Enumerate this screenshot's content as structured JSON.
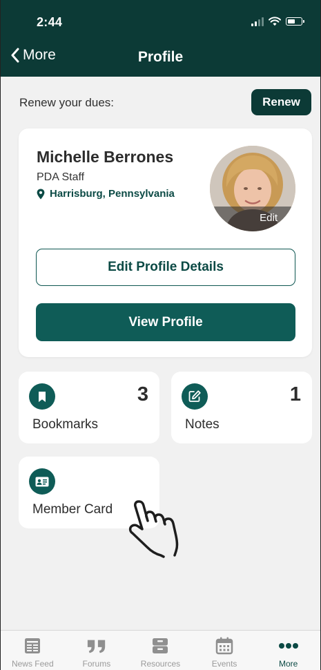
{
  "status": {
    "time": "2:44"
  },
  "nav": {
    "back_label": "More",
    "title": "Profile"
  },
  "renew": {
    "label": "Renew your dues:",
    "button_label": "Renew"
  },
  "profile": {
    "name": "Michelle Berrones",
    "role": "PDA Staff",
    "location": "Harrisburg, Pennsylvania",
    "avatar_edit_label": "Edit",
    "edit_button_label": "Edit Profile Details",
    "view_button_label": "View Profile"
  },
  "tiles": [
    {
      "label": "Bookmarks",
      "count": "3",
      "icon": "bookmark-icon"
    },
    {
      "label": "Notes",
      "count": "1",
      "icon": "edit-note-icon"
    },
    {
      "label": "Member Card",
      "icon": "id-card-icon"
    }
  ],
  "tabs": [
    {
      "label": "News Feed",
      "icon": "newspaper-icon",
      "active": false
    },
    {
      "label": "Forums",
      "icon": "quote-icon",
      "active": false
    },
    {
      "label": "Resources",
      "icon": "drawer-icon",
      "active": false
    },
    {
      "label": "Events",
      "icon": "calendar-icon",
      "active": false
    },
    {
      "label": "More",
      "icon": "more-dots-icon",
      "active": true
    }
  ],
  "colors": {
    "header": "#0c3a36",
    "primary": "#0f5c57",
    "background": "#f1f1f1"
  }
}
